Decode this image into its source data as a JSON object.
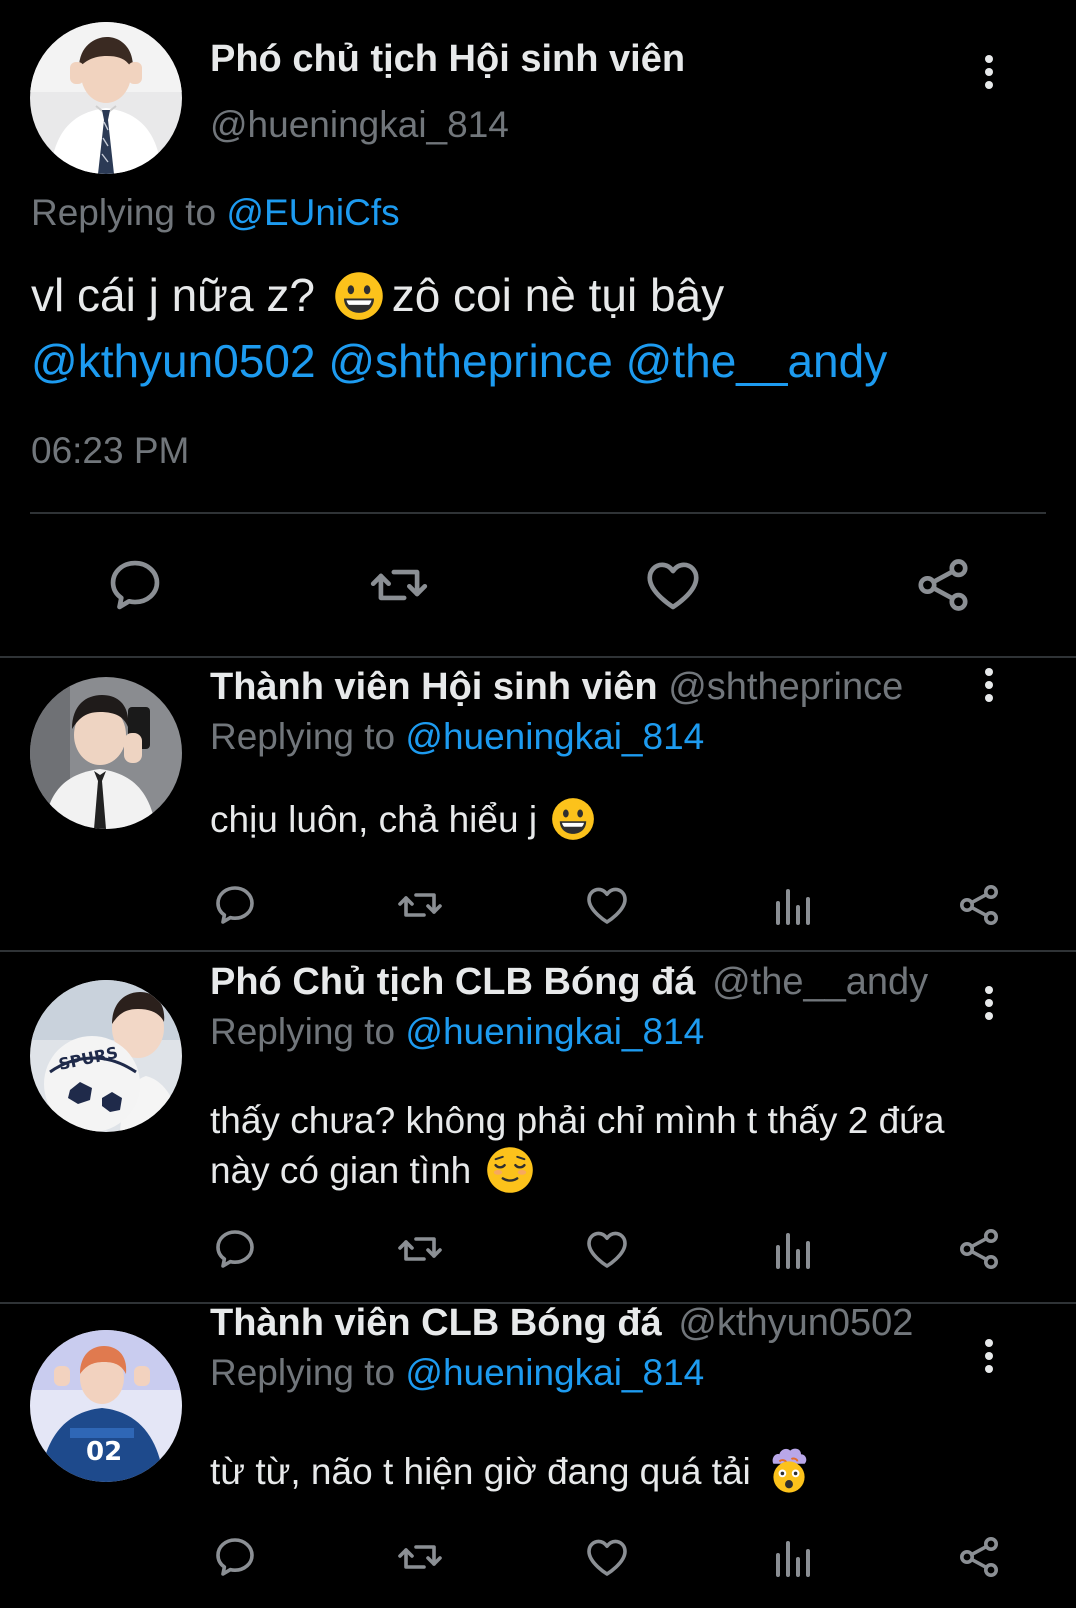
{
  "main_tweet": {
    "display_name": "Phó chủ tịch Hội sinh viên",
    "handle": "@hueningkai_814",
    "replying_prefix": "Replying to ",
    "replying_to": "@EUniCfs",
    "text_line1": "vl cái j nữa z?",
    "text_line1_after": "zô coi nè tụi bây",
    "mentions": [
      "@kthyun0502",
      "@shtheprince",
      "@the__andy"
    ],
    "time": "06:23 PM",
    "emoji": "grinning-face"
  },
  "replies": [
    {
      "display_name": "Thành viên Hội sinh viên",
      "handle": "@shtheprince",
      "replying_prefix": "Replying to ",
      "replying_to": "@hueningkai_814",
      "text": "chịu luôn, chả hiểu j",
      "text_line2": "",
      "emoji": "grinning-face"
    },
    {
      "display_name": "Phó Chủ tịch CLB Bóng đá",
      "handle": "@the__andy",
      "replying_prefix": "Replying to ",
      "replying_to": "@hueningkai_814",
      "text": "thấy chưa? không phải chỉ mình t thấy 2 đứa",
      "text_line2": "này có gian tình",
      "emoji": "relieved-face"
    },
    {
      "display_name": "Thành viên CLB Bóng đá",
      "handle": "@kthyun0502",
      "replying_prefix": "Replying to ",
      "replying_to": "@hueningkai_814",
      "text": "từ từ, não t hiện giờ đang quá tải",
      "text_line2": "",
      "emoji": "exploding-head"
    }
  ],
  "colors": {
    "background": "#000000",
    "text": "#e7e9ea",
    "muted": "#71767b",
    "link": "#1d9bf0",
    "divider": "#2f3336"
  },
  "icons": [
    "reply-icon",
    "retweet-icon",
    "like-icon",
    "analytics-icon",
    "share-icon",
    "more-icon"
  ]
}
